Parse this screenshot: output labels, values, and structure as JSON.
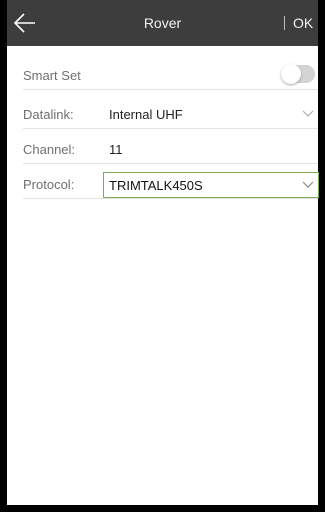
{
  "header": {
    "title": "Rover",
    "ok_label": "OK",
    "back_icon": "arrow-left-icon"
  },
  "form": {
    "smart_set": {
      "label": "Smart Set",
      "enabled": false
    },
    "datalink": {
      "label": "Datalink:",
      "value": "Internal UHF"
    },
    "channel": {
      "label": "Channel:",
      "value": "11"
    },
    "protocol": {
      "label": "Protocol:",
      "value": "TRIMTALK450S"
    }
  },
  "colors": {
    "header_bg": "#3d3d3d",
    "focus_border": "#7daa52",
    "toggle_off": "#d4d4d4"
  }
}
